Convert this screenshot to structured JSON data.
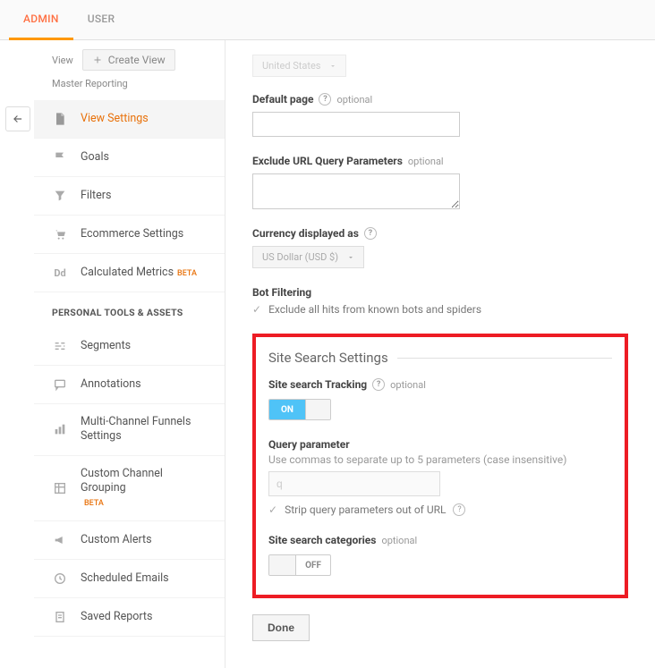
{
  "tabs": {
    "admin": "ADMIN",
    "user": "USER"
  },
  "sidebar": {
    "view_label": "View",
    "create_btn": "Create View",
    "master": "Master Reporting",
    "items": [
      {
        "label": "View Settings"
      },
      {
        "label": "Goals"
      },
      {
        "label": "Filters"
      },
      {
        "label": "Ecommerce Settings"
      },
      {
        "label": "Calculated Metrics",
        "beta": "BETA"
      }
    ],
    "section": "PERSONAL TOOLS & ASSETS",
    "tools": [
      {
        "label": "Segments"
      },
      {
        "label": "Annotations"
      },
      {
        "label": "Multi-Channel Funnels Settings"
      },
      {
        "label": "Custom Channel Grouping",
        "beta": "BETA"
      },
      {
        "label": "Custom Alerts"
      },
      {
        "label": "Scheduled Emails"
      },
      {
        "label": "Saved Reports"
      }
    ]
  },
  "content": {
    "country_selected": "United States",
    "default_page": {
      "label": "Default page",
      "optional": "optional"
    },
    "exclude_params": {
      "label": "Exclude URL Query Parameters",
      "optional": "optional"
    },
    "currency": {
      "label": "Currency displayed as",
      "selected": "US Dollar (USD $)"
    },
    "bot": {
      "label": "Bot Filtering",
      "checkbox": "Exclude all hits from known bots and spiders"
    },
    "site_search": {
      "title": "Site Search Settings",
      "tracking_label": "Site search Tracking",
      "optional": "optional",
      "on": "ON",
      "query_label": "Query parameter",
      "query_hint": "Use commas to separate up to 5 parameters (case insensitive)",
      "query_value": "q",
      "strip_label": "Strip query parameters out of URL",
      "categories_label": "Site search categories",
      "off": "OFF"
    },
    "done": "Done"
  }
}
